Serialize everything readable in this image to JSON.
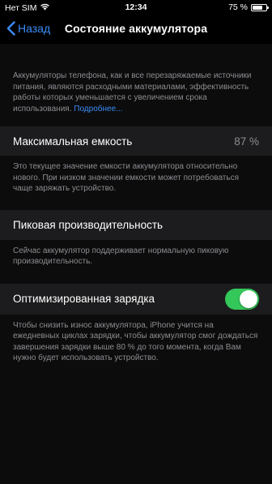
{
  "status_bar": {
    "carrier": "Нет SIM",
    "time": "12:34",
    "battery_percent_text": "75 %",
    "battery_level": 0.75
  },
  "nav": {
    "back_label": "Назад",
    "title": "Состояние аккумулятора"
  },
  "intro": {
    "text": "Аккумуляторы телефона, как и все перезаряжаемые источники питания, являются расходными материалами, эффективность работы которых уменьшается с увеличением срока использования. ",
    "link": "Подробнее..."
  },
  "max_capacity": {
    "label": "Максимальная емкость",
    "value": "87 %",
    "footnote": "Это текущее значение емкости аккумулятора относительно нового. При низком значении емкости может потребоваться чаще заряжать устройство."
  },
  "peak_performance": {
    "label": "Пиковая производительность",
    "footnote": "Сейчас аккумулятор поддерживает нормальную пиковую производительность."
  },
  "optimized_charging": {
    "label": "Оптимизированная зарядка",
    "enabled": true,
    "footnote": "Чтобы снизить износ аккумулятора, iPhone учится на ежедневных циклах зарядки, чтобы аккумулятор смог дождаться завершения зарядки выше 80 % до того момента, когда Вам нужно будет использовать устройство."
  },
  "colors": {
    "accent": "#3b8cf7",
    "toggle_on": "#34c759",
    "row_bg": "#1c1c1e",
    "secondary_text": "#8d8d93"
  }
}
